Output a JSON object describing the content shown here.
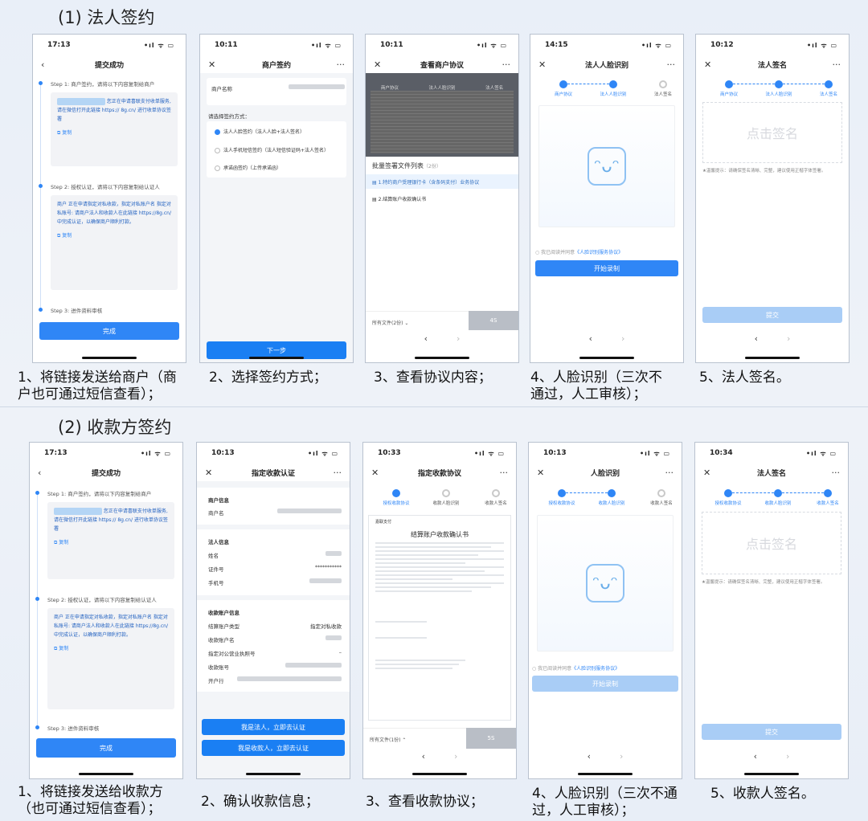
{
  "section1": {
    "title": "(1) 法人签约"
  },
  "section2": {
    "title": "(2) 收款方签约"
  },
  "status": {
    "t1": "17:13",
    "t2": "10:11",
    "t3": "10:11",
    "t4": "14:15",
    "t5": "10:12",
    "t6": "17:13",
    "t7": "10:13",
    "t8": "10:33",
    "t9": "10:13",
    "t10": "10:34",
    "icons": "•ıl ᯤ ▭"
  },
  "submit": {
    "title": "提交成功",
    "back": "‹",
    "step1": "Step 1:  商户签约，请将以下内容复制给商户",
    "step1_text": "您正在申请喜联支付收单服务,请在微信打开此链接 https:// 8g.cn/ 进行收单协议签署",
    "copy": "复制",
    "step2": "Step 2:  授权认证，请将以下内容复制给认证人",
    "step2_text": "商户 正在申请指定对私收款，指定对私账户名 指定对私账号: 请商户法人和收款人在此链接 https://8g.cn/ 中完成认证，以确保商户顺利打款。",
    "step3": "Step 3:  进件资料审核",
    "done": "完成"
  },
  "sign": {
    "title": "商户签约",
    "close": "✕",
    "more": "···",
    "merchant": "商户名称",
    "choose": "请选择签约方式：",
    "opt1": "法人人脸签约（法人人脸+法人签名）",
    "opt2": "法人手机短信签约（法人短信验证码+法人签名）",
    "opt3": "承诺函签约（上传承诺函）",
    "next": "下一步"
  },
  "view": {
    "title": "查看商户协议",
    "tabs": [
      "商户协议",
      "法人人脸识别",
      "法人签名"
    ],
    "list_title": "批量签署文件列表",
    "list_count": "（2份）",
    "file1": "1.特约商户受理银行卡（含条码支付）业务协议",
    "file2": "2.结算账户收款确认书",
    "all": "所有文件(2份) ⌄",
    "countdown": "4S"
  },
  "face": {
    "title": "法人人脸识别",
    "steps": [
      "商户协议",
      "法人人脸识别",
      "法人签名"
    ],
    "agree": "我已阅读并同意",
    "agree_link": "《人脸识别服务协议》",
    "start": "开始录制"
  },
  "legal": {
    "title": "法人签名",
    "steps": [
      "商户协议",
      "法人人脸识别",
      "法人签名"
    ],
    "placeholder": "点击签名",
    "hint": "★温馨提示：请确保签名清晰、完整，建议使用正楷字体签署。",
    "submit": "提交"
  },
  "nav": {
    "prev": "‹",
    "next": "›"
  },
  "auth": {
    "title": "指定收款认证",
    "merchant_h": "商户信息",
    "merchant_name": "商户名",
    "legal_h": "法人信息",
    "name": "姓名",
    "id": "证件号",
    "id_val": "***********",
    "phone": "手机号",
    "acct_h": "收款账户信息",
    "type": "结算账户类型",
    "type_val": "指定对私收款",
    "acct_name": "收款账户名",
    "license": "指定对公营业执照号",
    "license_val": "–",
    "acct_no": "收款账号",
    "bank": "开户行",
    "btn1": "我是法人，立即去认证",
    "btn2": "我是收款人，立即去认证"
  },
  "payee_doc": {
    "title": "指定收款协议",
    "steps": [
      "授权收款协议",
      "收款人脸识别",
      "收款人签名"
    ],
    "doc_brand": "嘉联支付",
    "doc_title": "结算账户收款确认书",
    "all": "所有文件(1份) ⌃",
    "countdown": "5S"
  },
  "payee_face": {
    "title": "人脸识别",
    "steps": [
      "授权收款协议",
      "收款人脸识别",
      "收款人签名"
    ],
    "agree": "我已阅读并同意",
    "agree_link": "《人脸识别服务协议》",
    "start": "开始录制"
  },
  "payee_sign": {
    "title": "法人签名",
    "steps": [
      "授权收款协议",
      "收款人脸识别",
      "收款人签名"
    ],
    "placeholder": "点击签名",
    "hint": "★温馨提示：请确保签名清晰、完整，建议使用正楷字体签署。",
    "submit": "提交"
  },
  "captions": {
    "c1": "1、将链接发送给商户（商户也可通过短信查看）；",
    "c2": "2、选择签约方式；",
    "c3": "3、查看协议内容；",
    "c4": "4、人脸识别（三次不通过，人工审核）；",
    "c5": "5、法人签名。",
    "d1": "1、将链接发送给收款方（也可通过短信查看）；",
    "d2": "2、确认收款信息；",
    "d3": "3、查看收款协议；",
    "d4": "4、人脸识别（三次不通过，人工审核）；",
    "d5": "5、收款人签名。"
  }
}
